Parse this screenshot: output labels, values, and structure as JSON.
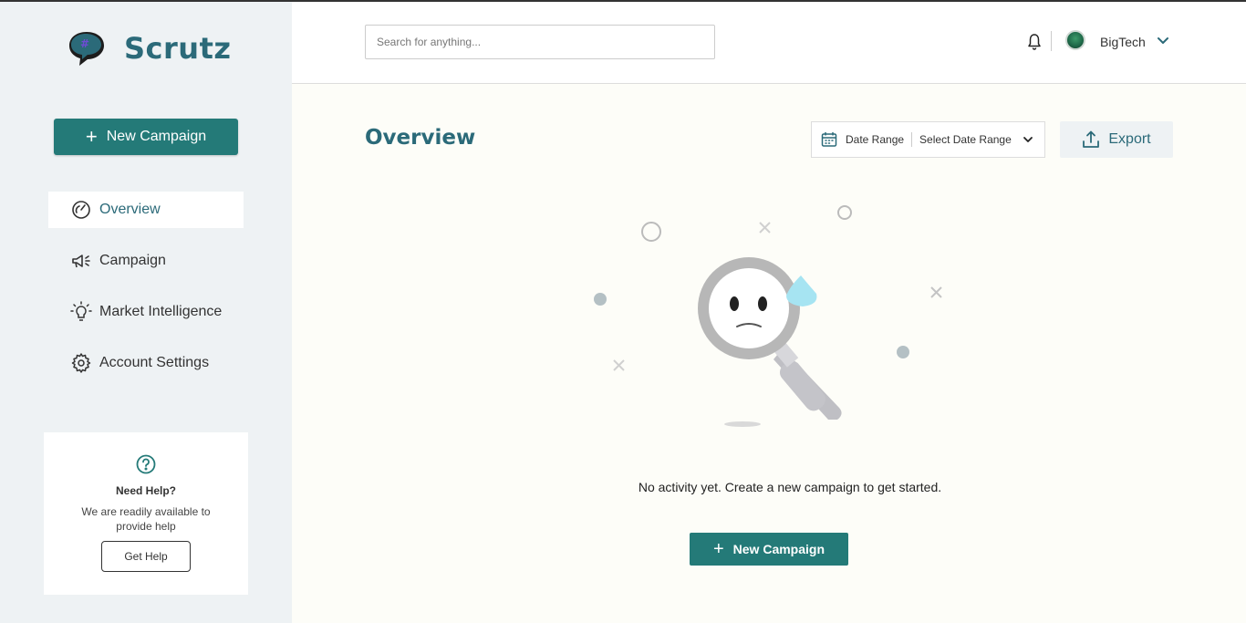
{
  "app": {
    "brand_name": "Scrutz"
  },
  "sidebar": {
    "new_campaign_label": "New Campaign",
    "items": [
      {
        "label": "Overview",
        "icon": "speedometer-icon",
        "active": true
      },
      {
        "label": "Campaign",
        "icon": "megaphone-icon",
        "active": false
      },
      {
        "label": "Market Intelligence",
        "icon": "lightbulb-icon",
        "active": false
      },
      {
        "label": "Account Settings",
        "icon": "gear-icon",
        "active": false
      }
    ],
    "help": {
      "title": "Need Help?",
      "text": "We are readily available to provide help",
      "button_label": "Get Help"
    }
  },
  "header": {
    "search_placeholder": "Search for anything...",
    "user_name": "BigTech"
  },
  "main": {
    "page_title": "Overview",
    "date_range": {
      "label": "Date Range",
      "value": "Select Date Range"
    },
    "export_label": "Export",
    "empty_state": {
      "message": "No activity yet. Create a new campaign to get started.",
      "button_label": "New Campaign"
    }
  },
  "colors": {
    "brand_teal": "#247a78",
    "title_teal": "#2b6a79",
    "sidebar_bg": "#eef2f4",
    "main_bg": "#fdfdf8"
  }
}
